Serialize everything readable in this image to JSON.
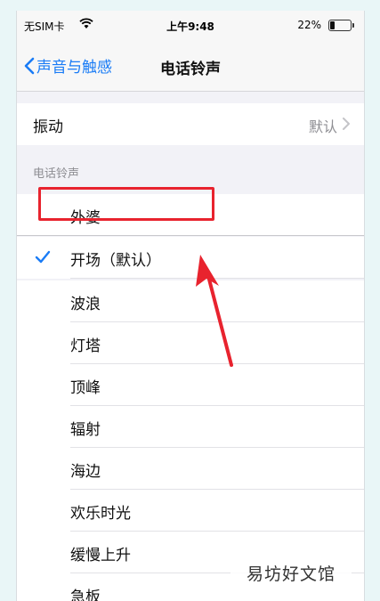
{
  "status_bar": {
    "carrier": "无SIM卡",
    "time": "上午9:48",
    "battery": "22%",
    "battery_level": 0.22
  },
  "nav": {
    "back_label": "声音与触感",
    "title": "电话铃声"
  },
  "vibration": {
    "label": "振动",
    "value": "默认"
  },
  "section_header": "电话铃声",
  "ringtones": [
    {
      "name": "外婆",
      "selected": false
    },
    {
      "name": "开场（默认）",
      "selected": true
    },
    {
      "name": "波浪",
      "selected": false
    },
    {
      "name": "灯塔",
      "selected": false
    },
    {
      "name": "顶峰",
      "selected": false
    },
    {
      "name": "辐射",
      "selected": false
    },
    {
      "name": "海边",
      "selected": false
    },
    {
      "name": "欢乐时光",
      "selected": false
    },
    {
      "name": "缓慢上升",
      "selected": false
    },
    {
      "name": "急板",
      "selected": false
    }
  ],
  "colors": {
    "accent": "#1a7cf6",
    "annotation": "#e8232e"
  },
  "watermark": "易坊好文馆"
}
